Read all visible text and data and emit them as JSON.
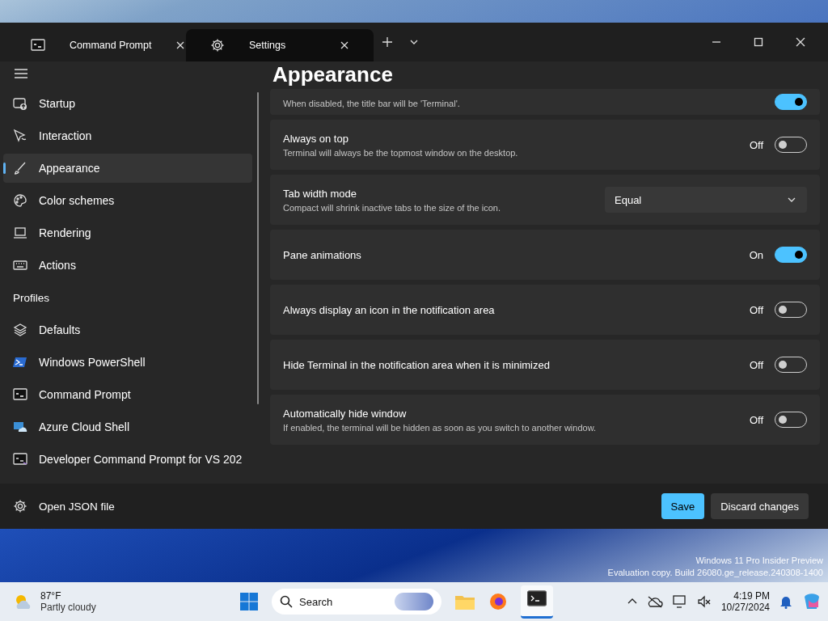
{
  "tabs": [
    {
      "label": "Command Prompt",
      "selected": false
    },
    {
      "label": "Settings",
      "selected": true
    }
  ],
  "nav": {
    "items": [
      {
        "label": "Startup",
        "selected": false
      },
      {
        "label": "Interaction",
        "selected": false
      },
      {
        "label": "Appearance",
        "selected": true
      },
      {
        "label": "Color schemes",
        "selected": false
      },
      {
        "label": "Rendering",
        "selected": false
      },
      {
        "label": "Actions",
        "selected": false
      }
    ],
    "profiles_heading": "Profiles",
    "profiles": [
      {
        "label": "Defaults",
        "selected": false
      },
      {
        "label": "Windows PowerShell",
        "selected": false
      },
      {
        "label": "Command Prompt",
        "selected": false
      },
      {
        "label": "Azure Cloud Shell",
        "selected": false
      },
      {
        "label": "Developer Command Prompt for VS 202",
        "selected": false
      }
    ],
    "open_json": "Open JSON file"
  },
  "page_title": "Appearance",
  "settings": [
    {
      "kind": "partial",
      "description": "When disabled, the title bar will be 'Terminal'.",
      "on": true
    },
    {
      "kind": "toggle",
      "title": "Always on top",
      "description": "Terminal will always be the topmost window on the desktop.",
      "state_text": "Off",
      "on": false
    },
    {
      "kind": "dropdown",
      "title": "Tab width mode",
      "description": "Compact will shrink inactive tabs to the size of the icon.",
      "value": "Equal"
    },
    {
      "kind": "toggle",
      "title": "Pane animations",
      "state_text": "On",
      "on": true
    },
    {
      "kind": "toggle",
      "title": "Always display an icon in the notification area",
      "state_text": "Off",
      "on": false
    },
    {
      "kind": "toggle",
      "title": "Hide Terminal in the notification area when it is minimized",
      "state_text": "Off",
      "on": false
    },
    {
      "kind": "toggle",
      "title": "Automatically hide window",
      "description": "If enabled, the terminal will be hidden as soon as you switch to another window.",
      "state_text": "Off",
      "on": false
    }
  ],
  "buttons": {
    "save": "Save",
    "discard": "Discard changes"
  },
  "desktop": {
    "watermark": [
      "Windows 11 Pro Insider Preview",
      "Evaluation copy. Build 26080.ge_release.240308-1400"
    ]
  },
  "taskbar": {
    "weather": {
      "temp": "87°F",
      "condition": "Partly cloudy"
    },
    "search": "Search",
    "time": "4:19 PM",
    "date": "10/27/2024"
  }
}
